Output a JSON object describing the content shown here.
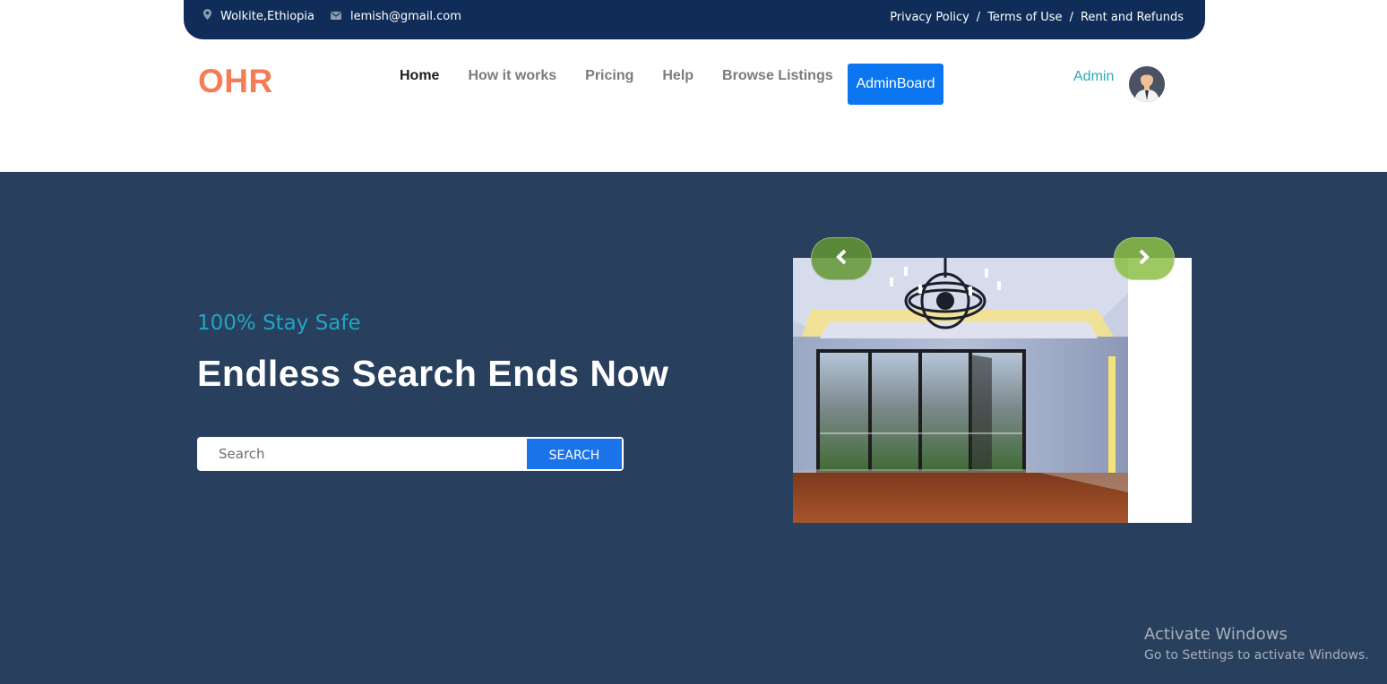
{
  "topbar": {
    "location": "Wolkite,Ethiopia",
    "email": "lemish@gmail.com",
    "links": [
      "Privacy Policy",
      "Terms of Use",
      "Rent and Refunds"
    ],
    "separator": "/",
    "location_icon": "map-marker-icon",
    "email_icon": "envelope-icon",
    "background": "#0f2d58"
  },
  "header": {
    "logo": "OHR",
    "nav": [
      "Home",
      "How it works",
      "Pricing",
      "Help",
      "Browse Listings"
    ],
    "active_nav": "Home",
    "admin_board_button": "AdminBoard",
    "user_label": "Admin",
    "avatar_icon": "user-avatar-icon"
  },
  "hero": {
    "tagline": "100% Stay Safe",
    "headline": "Endless Search Ends Now",
    "search": {
      "placeholder": "Search",
      "button": "SEARCH"
    },
    "carousel": {
      "prev_icon": "chevron-left-icon",
      "next_icon": "chevron-right-icon"
    },
    "background": "#283f5e"
  },
  "watermark": {
    "title": "Activate Windows",
    "subtitle": "Go to Settings to activate Windows."
  },
  "colors": {
    "logo": "#f47c57",
    "accent_teal": "#21a6c2",
    "button_blue": "#0b76ef"
  }
}
